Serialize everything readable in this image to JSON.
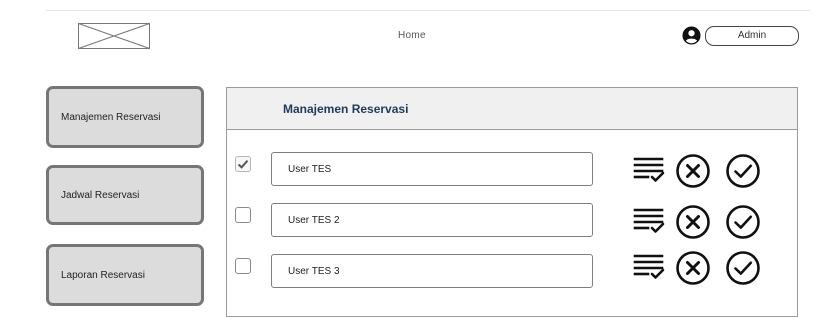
{
  "header": {
    "nav_home": "Home",
    "admin_label": "Admin"
  },
  "sidebar": {
    "items": [
      {
        "label": "Manajemen Reservasi"
      },
      {
        "label": "Jadwal Reservasi"
      },
      {
        "label": "Laporan Reservasi"
      }
    ]
  },
  "main": {
    "title": "Manajemen Reservasi",
    "rows": [
      {
        "name": "User TES",
        "checked": true
      },
      {
        "name": "User TES 2",
        "checked": false
      },
      {
        "name": "User TES 3",
        "checked": false
      }
    ]
  },
  "icons": {
    "logo": "image-placeholder-icon",
    "user": "user-circle-icon",
    "detail": "list-check-icon",
    "reject": "x-circle-icon",
    "approve": "check-circle-icon"
  },
  "colors": {
    "title_text": "#1f3a5a",
    "sidebar_bg": "#dcdcdc",
    "sidebar_border": "#767676"
  }
}
